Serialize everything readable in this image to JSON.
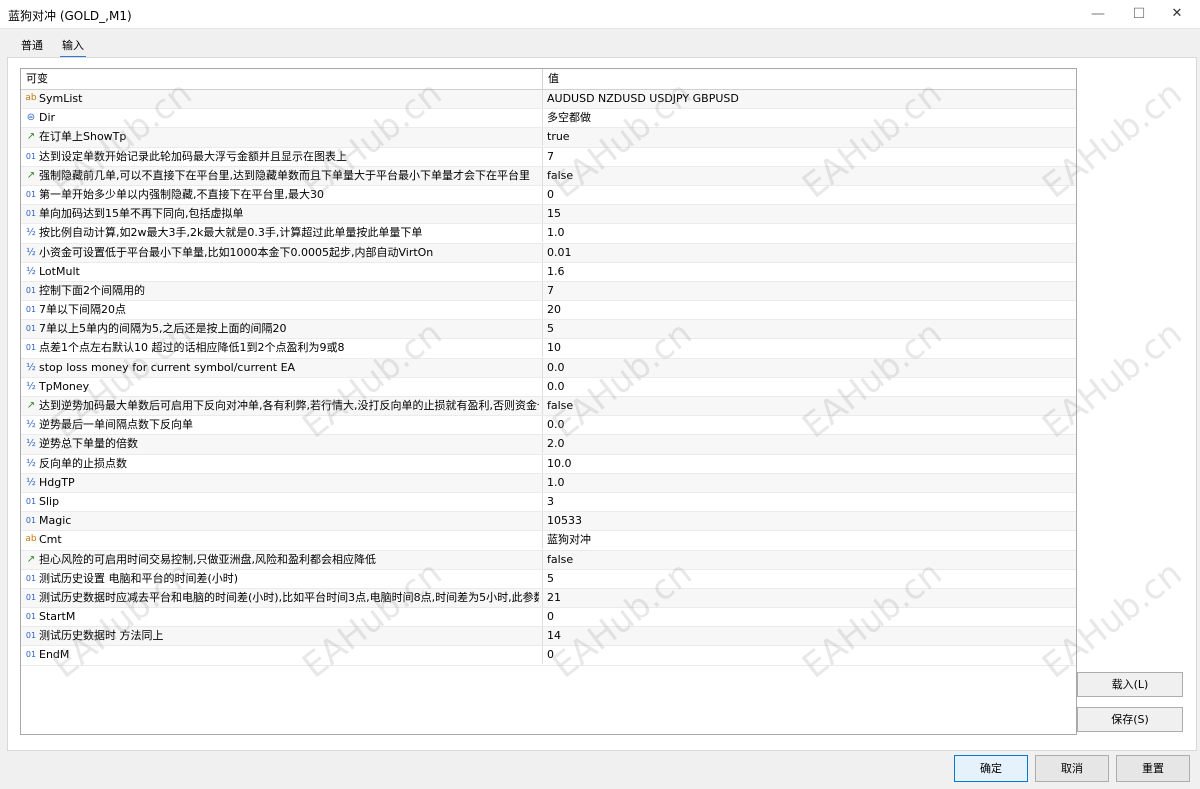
{
  "window": {
    "title": "蓝狗对冲 (GOLD_,M1)",
    "minimize_glyph": "—",
    "maximize_glyph": "☐",
    "close_glyph": "✕"
  },
  "tabs": [
    {
      "label": "普通",
      "selected": false
    },
    {
      "label": "输入",
      "selected": true
    }
  ],
  "grid": {
    "header": {
      "variable": "可变",
      "value": "值"
    },
    "rows": [
      {
        "icon": "ab",
        "name": "SymList",
        "value": "AUDUSD NZDUSD USDJPY GBPUSD"
      },
      {
        "icon": "⊜",
        "name": "Dir",
        "value": "多空都做"
      },
      {
        "icon": "↗",
        "name": "在订单上ShowTp",
        "value": "true"
      },
      {
        "icon": "01",
        "name": "达到设定单数开始记录此轮加码最大浮亏金额并且显示在图表上",
        "value": "7"
      },
      {
        "icon": "↗",
        "name": "强制隐藏前几单,可以不直接下在平台里,达到隐藏单数而且下单量大于平台最小下单量才会下在平台里",
        "value": "false"
      },
      {
        "icon": "01",
        "name": "第一单开始多少单以内强制隐藏,不直接下在平台里,最大30",
        "value": "0"
      },
      {
        "icon": "01",
        "name": "单向加码达到15单不再下同向,包括虚拟单",
        "value": "15"
      },
      {
        "icon": "½",
        "name": "按比例自动计算,如2w最大3手,2k最大就是0.3手,计算超过此单量按此单量下单",
        "value": "1.0"
      },
      {
        "icon": "½",
        "name": "小资金可设置低于平台最小下单量,比如1000本金下0.0005起步,内部自动VirtOn",
        "value": "0.01"
      },
      {
        "icon": "½",
        "name": "LotMult",
        "value": "1.6"
      },
      {
        "icon": "01",
        "name": "控制下面2个间隔用的",
        "value": "7"
      },
      {
        "icon": "01",
        "name": "7单以下间隔20点",
        "value": "20"
      },
      {
        "icon": "01",
        "name": "7单以上5单内的间隔为5,之后还是按上面的间隔20",
        "value": "5"
      },
      {
        "icon": "01",
        "name": "点差1个点左右默认10   超过的话相应降低1到2个点盈利为9或8",
        "value": "10"
      },
      {
        "icon": "½",
        "name": "stop loss money for current symbol/current EA",
        "value": "0.0"
      },
      {
        "icon": "½",
        "name": "TpMoney",
        "value": "0.0"
      },
      {
        "icon": "↗",
        "name": "达到逆势加码最大单数后可启用下反向对冲单,各有利弊,若行情大,没打反向单的止损就有盈利,否则资金也会...",
        "value": "false"
      },
      {
        "icon": "½",
        "name": "逆势最后一单间隔点数下反向单",
        "value": "0.0"
      },
      {
        "icon": "½",
        "name": "逆势总下单量的倍数",
        "value": "2.0"
      },
      {
        "icon": "½",
        "name": "反向单的止损点数",
        "value": "10.0"
      },
      {
        "icon": "½",
        "name": "HdgTP",
        "value": "1.0"
      },
      {
        "icon": "01",
        "name": "Slip",
        "value": "3"
      },
      {
        "icon": "01",
        "name": "Magic",
        "value": "10533"
      },
      {
        "icon": "ab",
        "name": "Cmt",
        "value": "蓝狗对冲"
      },
      {
        "icon": "↗",
        "name": "担心风险的可启用时间交易控制,只做亚洲盘,风险和盈利都会相应降低",
        "value": "false"
      },
      {
        "icon": "01",
        "name": "测试历史设置 电脑和平台的时间差(小时)",
        "value": "5"
      },
      {
        "icon": "01",
        "name": "测试历史数据时应减去平台和电脑的时间差(小时),比如平台时间3点,电脑时间8点,时间差为5小时,此参数应该...",
        "value": "21"
      },
      {
        "icon": "01",
        "name": "StartM",
        "value": "0"
      },
      {
        "icon": "01",
        "name": "测试历史数据时 方法同上",
        "value": "14"
      },
      {
        "icon": "01",
        "name": "EndM",
        "value": "0"
      }
    ]
  },
  "buttons": {
    "load": "载入(L)",
    "save": "保存(S)",
    "ok": "确定",
    "cancel": "取消",
    "reset": "重置"
  },
  "watermark_text": "EAHub.cn"
}
